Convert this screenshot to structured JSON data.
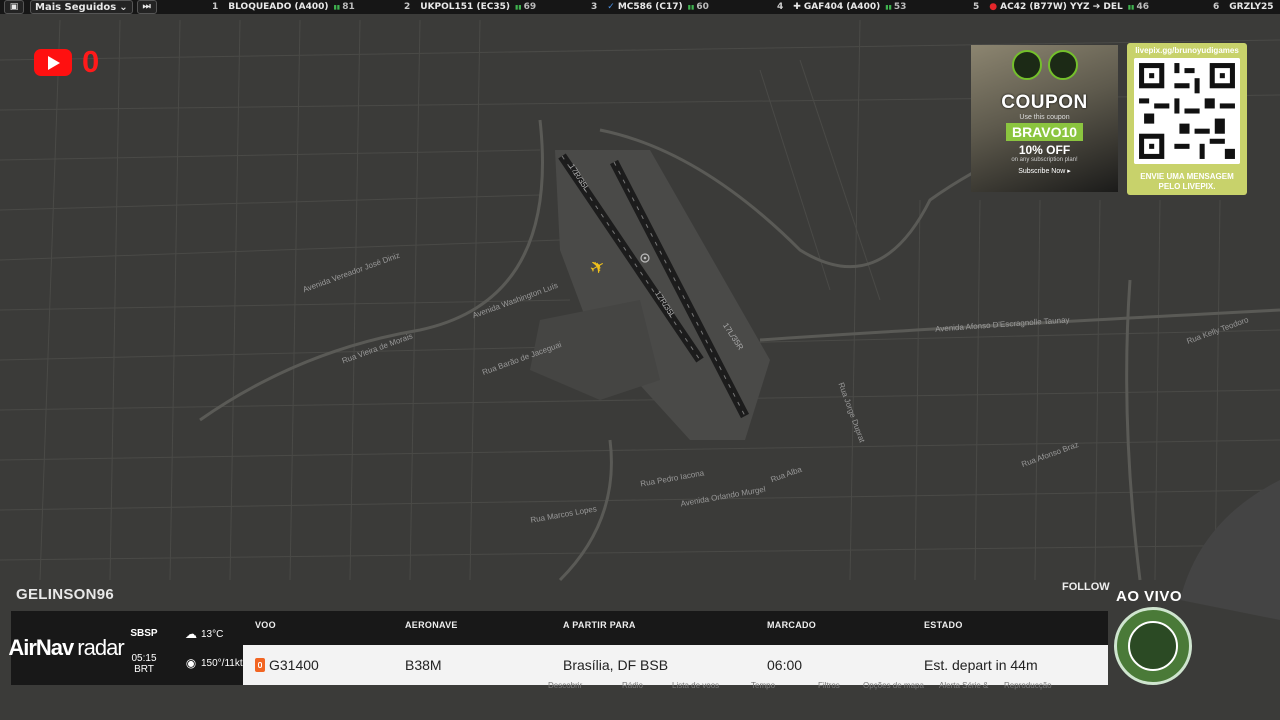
{
  "topbar": {
    "dropdown_label": "Mais Seguidos",
    "flights": [
      {
        "rank": "1",
        "label": "BLOQUEADO (A400)",
        "count": "81"
      },
      {
        "rank": "2",
        "label": "UKPOL151 (EC35)",
        "count": "69"
      },
      {
        "rank": "3",
        "label": "MC586 (C17)",
        "count": "60"
      },
      {
        "rank": "4",
        "label": "GAF404 (A400)",
        "count": "53"
      },
      {
        "rank": "5",
        "label": "AC42 (B77W) YYZ ➔ DEL",
        "count": "46"
      },
      {
        "rank": "6",
        "label": "GRZLY25",
        "count": ""
      }
    ]
  },
  "youtube": {
    "count": "0"
  },
  "map": {
    "runway_labels": [
      "17R/35L",
      "17R/35L",
      "17L/35R"
    ],
    "streets": [
      "Avenida Washington Luís",
      "Rua Marcos Lopes",
      "Avenida Afonso D'Escragnolle Taunay",
      "Rua Pedro Iacona",
      "Avenida Orlando Murgel",
      "Rua Vieira de Morais",
      "Rua Barão de Jaceguai",
      "Rua Alba",
      "Rua Kelly Teodoro",
      "Avenida Vereador José Diniz",
      "Rua Jorge Duprat",
      "Rua Afonso Braz"
    ]
  },
  "coupon": {
    "title": "COUPON",
    "sub": "Use this coupon",
    "code": "BRAVO10",
    "off": "10% OFF",
    "note": "on any subscription plan!",
    "footer": "Subscribe Now ▸"
  },
  "qr": {
    "top": "livepix.gg/brunoyudigames",
    "bottom_line1": "ENVIE UMA MENSAGEM",
    "bottom_line2": "PELO LIVEPIX."
  },
  "username": "GELINSON96",
  "follow": "FOLLOW",
  "panel": {
    "brand_bold": "AirNav",
    "brand_light": "radar",
    "airport_code": "SBSP",
    "local_time": "05:15 BRT",
    "temperature": "13°C",
    "wind": "150°/11kts",
    "headers": {
      "flight": "VOO",
      "aircraft": "AERONAVE",
      "departing_to": "A PARTIR PARA",
      "scheduled": "MARCADO",
      "status": "ESTADO"
    },
    "row": {
      "flight": "G31400",
      "aircraft": "B38M",
      "destination": "Brasília, DF BSB",
      "scheduled": "06:00",
      "status": "Est. depart in 44m"
    }
  },
  "bottom_menu": [
    "Descobrir",
    "Rádio",
    "Lista de voos",
    "Tempo",
    "Filtros",
    "Opções de mapa",
    "Alerta Série &",
    "Reproducção"
  ],
  "live": {
    "label": "AO VIVO"
  },
  "colors": {
    "brand_green": "#3fb34f",
    "youtube_red": "#ff1010",
    "coupon_green": "#8bc53f",
    "qr_bg": "#c8d26b",
    "flight_logo": "#f26522"
  }
}
